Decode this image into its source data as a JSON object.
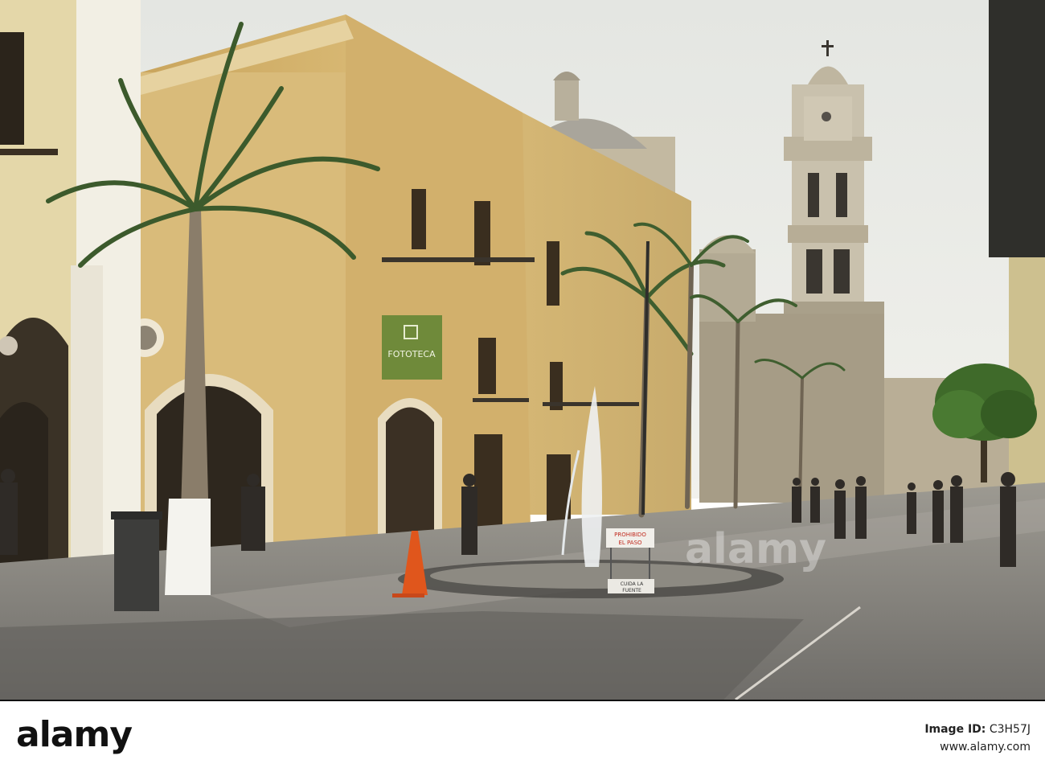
{
  "scene": {
    "sign_fototeca": "FOTOTECA",
    "sign_prohibido_line1": "PROHIBIDO",
    "sign_prohibido_line2": "EL PASO",
    "sign_cuida_line1": "CUIDA LA",
    "sign_cuida_line2": "FUENTE",
    "watermark": "alamy",
    "sky_color": "#e9ebe6",
    "facade_color": "#d8b66e",
    "cathedral_color": "#b9ad95",
    "paving_color": "#8e8c86"
  },
  "footer": {
    "brand": "alamy",
    "image_id_label": "Image ID:",
    "image_id": "C3H57J",
    "site": "www.alamy.com"
  }
}
